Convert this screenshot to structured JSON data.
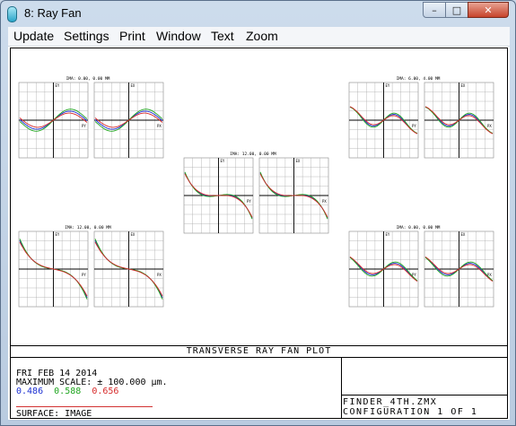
{
  "window": {
    "title": "8: Ray Fan",
    "controls": {
      "minimize": "–",
      "maximize": "□",
      "close": "✕"
    }
  },
  "menu": {
    "items": [
      "Update",
      "Settings",
      "Print",
      "Window",
      "Text",
      "Zoom"
    ]
  },
  "plot_footer": {
    "heading": "TRANSVERSE RAY FAN PLOT",
    "date": "FRI FEB 14 2014",
    "max_scale": "MAXIMUM SCALE: ± 100.000 µm.",
    "wavelengths": [
      "0.486",
      "0.588",
      "0.656"
    ],
    "surface": "SURFACE: IMAGE",
    "lens_file": "FINDER_4TH.ZMX",
    "configuration": "CONFIGURATION 1 OF 1"
  },
  "colors": {
    "blue": "#1b2fd2",
    "green": "#1fa51f",
    "red": "#d62828"
  },
  "fields": [
    {
      "label": "IMA: 0.00, 0.00 MM",
      "axis_y": "EY",
      "axis_x": "PY",
      "axis_y2": "EX",
      "axis_x2": "PX"
    },
    {
      "label": "IMA: 6.00, 4.00 MM",
      "axis_y": "EY",
      "axis_x": "PY",
      "axis_y2": "EX",
      "axis_x2": "PX"
    },
    {
      "label": "IMA: 12.00, 0.00 MM",
      "axis_y": "EY",
      "axis_x": "PY",
      "axis_y2": "EX",
      "axis_x2": "PX"
    },
    {
      "label": "IMA: 12.00, 0.00 MM",
      "axis_y": "EY",
      "axis_x": "PY",
      "axis_y2": "EX",
      "axis_x2": "PX"
    },
    {
      "label": "IMA: 0.00, 0.00 MM",
      "axis_y": "EY",
      "axis_x": "PY",
      "axis_y2": "EX",
      "axis_x2": "PX"
    }
  ]
}
